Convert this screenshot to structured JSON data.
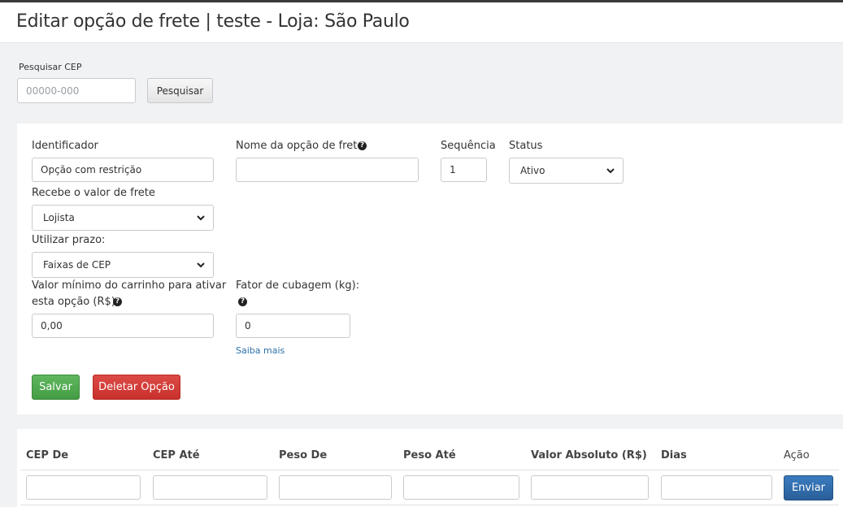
{
  "header": {
    "title": "Editar opção de frete | teste - Loja: São Paulo"
  },
  "search": {
    "label": "Pesquisar CEP",
    "placeholder": "00000-000",
    "button_label": "Pesquisar"
  },
  "form": {
    "identificador": {
      "label": "Identificador",
      "value": "Opção com restrição"
    },
    "nome": {
      "label": "Nome da opção de frete",
      "value": ""
    },
    "sequencia": {
      "label": "Sequência",
      "value": "1"
    },
    "status": {
      "label": "Status",
      "selected": "Ativo"
    },
    "recebe": {
      "label": "Recebe o valor de frete",
      "selected": "Lojista"
    },
    "prazo": {
      "label": "Utilizar prazo:",
      "selected": "Faixas de CEP"
    },
    "valor_minimo": {
      "label_line1": "Valor mínimo do carrinho para ativar",
      "label_line2": "esta opção (R$):",
      "value": "0,00"
    },
    "cubagem": {
      "label": "Fator de cubagem (kg):",
      "value": "0",
      "link": "Saiba mais"
    },
    "save_label": "Salvar",
    "delete_label": "Deletar Opção"
  },
  "table": {
    "headers": [
      "CEP De",
      "CEP Até",
      "Peso De",
      "Peso Até",
      "Valor Absoluto (R$)",
      "Dias",
      "Ação"
    ],
    "submit_label": "Enviar"
  },
  "icons": {
    "help": "question-circle-icon",
    "select": "chevron-down-icon"
  }
}
